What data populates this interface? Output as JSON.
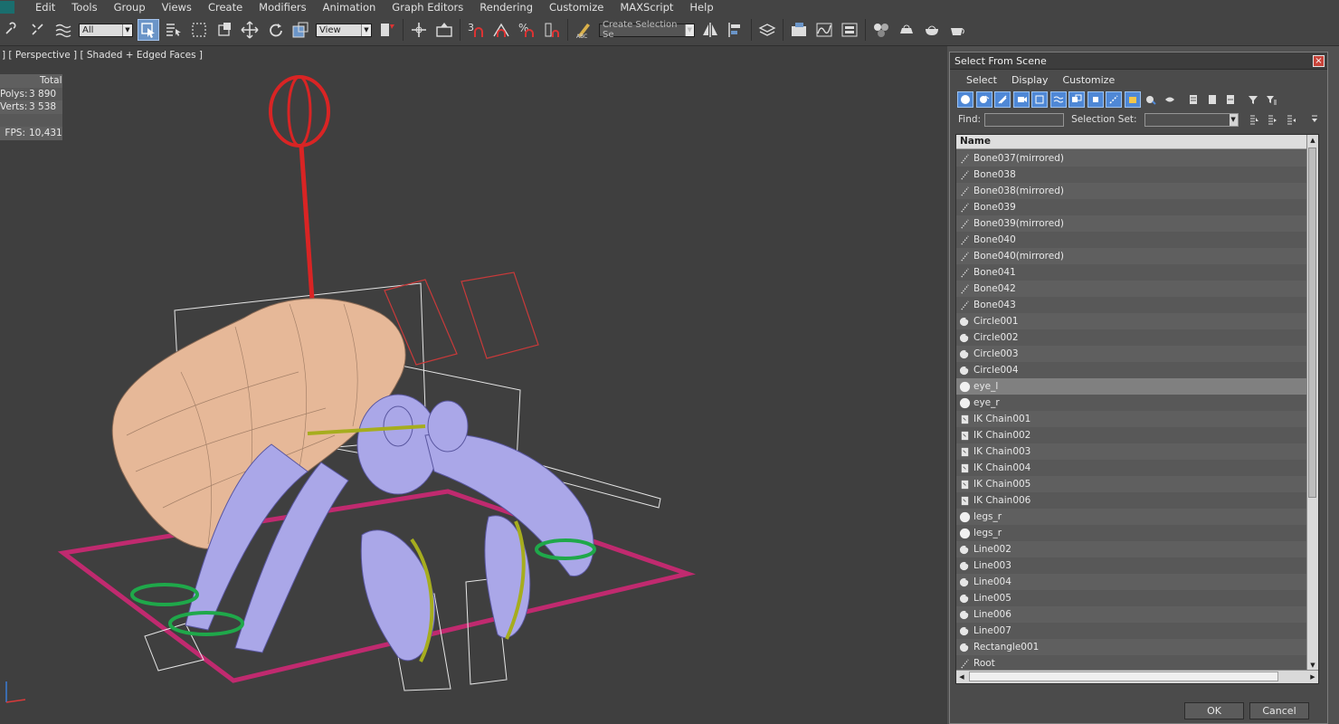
{
  "menubar": {
    "items": [
      "Edit",
      "Tools",
      "Group",
      "Views",
      "Create",
      "Modifiers",
      "Animation",
      "Graph Editors",
      "Rendering",
      "Customize",
      "MAXScript",
      "Help"
    ]
  },
  "toolbar": {
    "filter_value": "All",
    "coord_value": "View",
    "selection_set_placeholder": "Create Selection Se",
    "snap_number": "3",
    "percent_snap": "%"
  },
  "viewport": {
    "label": "] [ Perspective ] [ Shaded + Edged Faces ]",
    "stats": {
      "header": "Total",
      "polys_label": "Polys:",
      "polys_value": "3 890",
      "verts_label": "Verts:",
      "verts_value": "3 538",
      "fps_label": "FPS:",
      "fps_value": "10,431"
    }
  },
  "dialog": {
    "title": "Select From Scene",
    "close": "×",
    "menu": [
      "Select",
      "Display",
      "Customize"
    ],
    "find_label": "Find:",
    "selection_set_label": "Selection Set:",
    "column_header": "Name",
    "items": [
      {
        "name": "Bone037(mirrored)",
        "icon": "bone"
      },
      {
        "name": "Bone038",
        "icon": "bone"
      },
      {
        "name": "Bone038(mirrored)",
        "icon": "bone"
      },
      {
        "name": "Bone039",
        "icon": "bone"
      },
      {
        "name": "Bone039(mirrored)",
        "icon": "bone"
      },
      {
        "name": "Bone040",
        "icon": "bone"
      },
      {
        "name": "Bone040(mirrored)",
        "icon": "bone"
      },
      {
        "name": "Bone041",
        "icon": "bone"
      },
      {
        "name": "Bone042",
        "icon": "bone"
      },
      {
        "name": "Bone043",
        "icon": "bone"
      },
      {
        "name": "Circle001",
        "icon": "shape"
      },
      {
        "name": "Circle002",
        "icon": "shape"
      },
      {
        "name": "Circle003",
        "icon": "shape"
      },
      {
        "name": "Circle004",
        "icon": "shape"
      },
      {
        "name": "eye_l",
        "icon": "geometry",
        "selected": true
      },
      {
        "name": "eye_r",
        "icon": "geometry"
      },
      {
        "name": "IK Chain001",
        "icon": "ik"
      },
      {
        "name": "IK Chain002",
        "icon": "ik"
      },
      {
        "name": "IK Chain003",
        "icon": "ik"
      },
      {
        "name": "IK Chain004",
        "icon": "ik"
      },
      {
        "name": "IK Chain005",
        "icon": "ik"
      },
      {
        "name": "IK Chain006",
        "icon": "ik"
      },
      {
        "name": "legs_r",
        "icon": "geometry"
      },
      {
        "name": "legs_r",
        "icon": "geometry"
      },
      {
        "name": "Line002",
        "icon": "shape"
      },
      {
        "name": "Line003",
        "icon": "shape"
      },
      {
        "name": "Line004",
        "icon": "shape"
      },
      {
        "name": "Line005",
        "icon": "shape"
      },
      {
        "name": "Line006",
        "icon": "shape"
      },
      {
        "name": "Line007",
        "icon": "shape"
      },
      {
        "name": "Rectangle001",
        "icon": "shape"
      },
      {
        "name": "Root",
        "icon": "bone"
      }
    ],
    "ok_label": "OK",
    "cancel_label": "Cancel"
  },
  "colors": {
    "accent_blue": "#4f88d6",
    "stats_yellow": "#f1dc6b",
    "shell": "#e6b898",
    "crab": "#aaa7e8",
    "bounds_magenta": "#c02a6f",
    "control_red": "#d92424",
    "control_green": "#1fa84a",
    "control_olive": "#a6ad1e"
  }
}
